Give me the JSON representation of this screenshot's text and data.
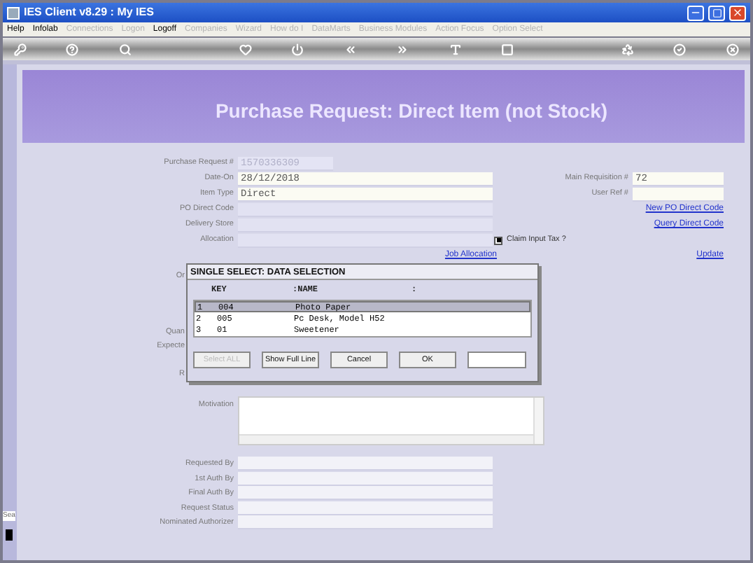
{
  "window": {
    "title": "IES Client v8.29 : My IES"
  },
  "menu": [
    {
      "label": "Help",
      "disabled": false
    },
    {
      "label": "Infolab",
      "disabled": false
    },
    {
      "label": "Connections",
      "disabled": true
    },
    {
      "label": "Logon",
      "disabled": true
    },
    {
      "label": "Logoff",
      "disabled": false
    },
    {
      "label": "Companies",
      "disabled": true
    },
    {
      "label": "Wizard",
      "disabled": true
    },
    {
      "label": "How do I",
      "disabled": true
    },
    {
      "label": "DataMarts",
      "disabled": true
    },
    {
      "label": "Business Modules",
      "disabled": true
    },
    {
      "label": "Action Focus",
      "disabled": true
    },
    {
      "label": "Option Select",
      "disabled": true
    }
  ],
  "side": {
    "label": "Sea"
  },
  "page_title": "Purchase Request: Direct Item (not Stock)",
  "form": {
    "left": [
      {
        "label": "Purchase Request #",
        "value": "1570336309",
        "kind": "readonly"
      },
      {
        "label": "Date-On",
        "value": "28/12/2018",
        "kind": "input"
      },
      {
        "label": "Item Type",
        "value": "Direct",
        "kind": "input"
      },
      {
        "label": "PO Direct Code",
        "kind": "blank"
      },
      {
        "label": "Delivery Store",
        "kind": "blank"
      },
      {
        "label": "Allocation",
        "kind": "blank"
      }
    ],
    "right": [
      {
        "label": "Main Requisition #",
        "value": "72"
      },
      {
        "label": "User Ref #"
      }
    ],
    "links": [
      "New PO Direct Code",
      "Query Direct Code"
    ],
    "claim_tax": {
      "label": "Claim Input Tax ?",
      "checked": true
    },
    "job_link": "Job Allocation",
    "update_link": "Update",
    "hidden_labels": [
      {
        "label": "Or"
      },
      {
        "label": "Quan"
      },
      {
        "label": "Expecte"
      },
      {
        "label": "R"
      }
    ],
    "motivation": {
      "label": "Motivation"
    },
    "lower": [
      {
        "label": "Requested By"
      },
      {
        "label": "1st Auth By"
      },
      {
        "label": "Final Auth By"
      },
      {
        "label": "Request Status"
      },
      {
        "label": "Nominated Authorizer"
      }
    ]
  },
  "dialog": {
    "title": "SINGLE SELECT: DATA SELECTION",
    "columns": [
      "KEY",
      ":NAME",
      ":"
    ],
    "rows": [
      {
        "index": "1",
        "key": "004",
        "name": "Photo Paper",
        "selected": true
      },
      {
        "index": "2",
        "key": "005",
        "name": "Pc Desk, Model H52",
        "selected": false
      },
      {
        "index": "3",
        "key": "01",
        "name": "Sweetener",
        "selected": false
      }
    ],
    "buttons": [
      {
        "label": "Select ALL",
        "disabled": true
      },
      {
        "label": "Show Full Line",
        "disabled": false
      },
      {
        "label": "Cancel",
        "disabled": false
      },
      {
        "label": "OK",
        "disabled": false
      }
    ]
  }
}
